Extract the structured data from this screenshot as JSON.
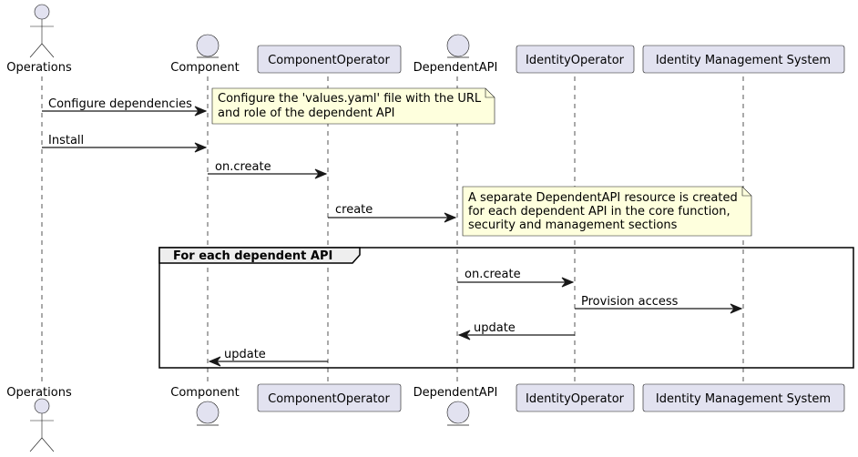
{
  "diagram": {
    "type": "sequence",
    "participants": [
      {
        "id": "operations",
        "label": "Operations",
        "kind": "actor"
      },
      {
        "id": "component",
        "label": "Component",
        "kind": "entity"
      },
      {
        "id": "componentoperator",
        "label": "ComponentOperator",
        "kind": "participant"
      },
      {
        "id": "dependentapi",
        "label": "DependentAPI",
        "kind": "entity"
      },
      {
        "id": "identityoperator",
        "label": "IdentityOperator",
        "kind": "participant"
      },
      {
        "id": "ims",
        "label": "Identity Management System",
        "kind": "participant"
      }
    ],
    "messages": [
      {
        "from": "operations",
        "to": "component",
        "label": "Configure dependencies"
      },
      {
        "from": "operations",
        "to": "component",
        "label": "Install"
      },
      {
        "from": "component",
        "to": "componentoperator",
        "label": "on.create"
      },
      {
        "from": "componentoperator",
        "to": "dependentapi",
        "label": "create"
      },
      {
        "from": "dependentapi",
        "to": "identityoperator",
        "label": "on.create"
      },
      {
        "from": "identityoperator",
        "to": "ims",
        "label": "Provision access"
      },
      {
        "from": "identityoperator",
        "to": "dependentapi",
        "label": "update"
      },
      {
        "from": "componentoperator",
        "to": "component",
        "label": "update"
      }
    ],
    "notes": [
      {
        "lines": [
          "Configure the 'values.yaml' file with the URL",
          "and role of the dependent API"
        ]
      },
      {
        "lines": [
          "A separate DependentAPI resource is created",
          "for each dependent API in the core function,",
          "security and management sections"
        ]
      }
    ],
    "group": {
      "label": "For each dependent API"
    }
  }
}
